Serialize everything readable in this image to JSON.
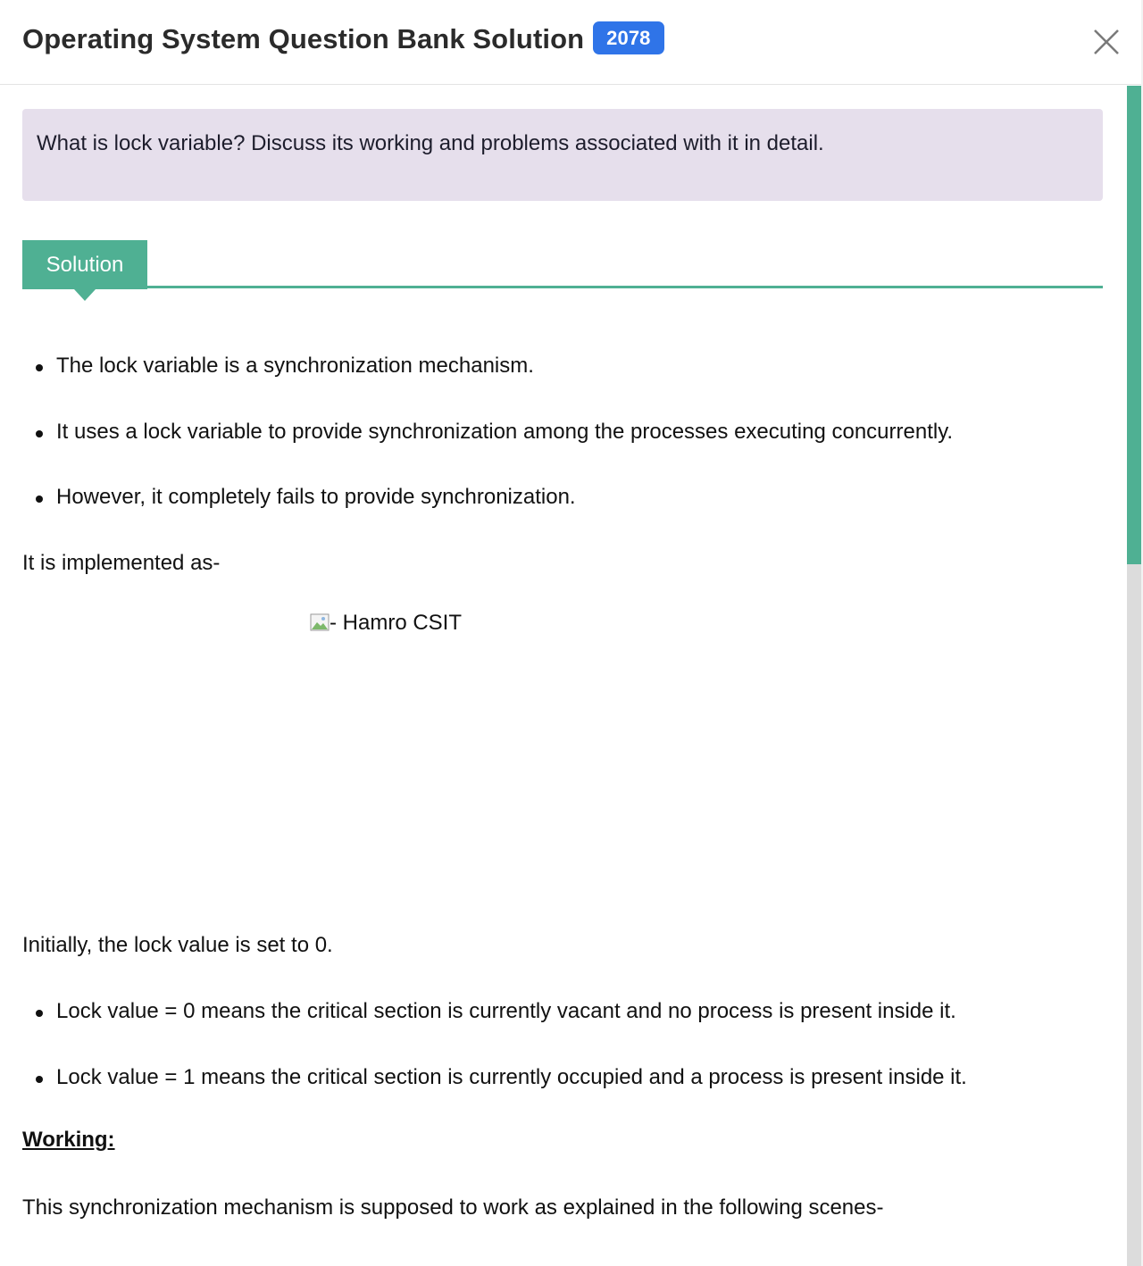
{
  "header": {
    "title": "Operating System Question Bank Solution",
    "year_badge": "2078"
  },
  "question": {
    "text": "What is lock variable? Discuss its working and problems associated with it in detail."
  },
  "solution_tab": {
    "label": "Solution"
  },
  "content": {
    "intro_bullets": [
      "The lock variable is a synchronization mechanism.",
      "It uses a lock variable to provide synchronization among the processes executing concurrently.",
      "However, it completely fails to provide synchronization."
    ],
    "implemented_as": "It is implemented as-",
    "image_alt": "- Hamro CSIT",
    "initially": "Initially, the lock value is set to 0.",
    "lock_bullets": [
      "Lock value = 0 means the critical section is currently vacant and no process is present inside it.",
      "Lock value = 1 means the critical section is currently occupied and a process is present inside it."
    ],
    "working_heading": "Working:",
    "working_text": "This synchronization mechanism is supposed to work as explained in the following scenes-"
  },
  "colors": {
    "accent_green": "#4fb093",
    "badge_blue": "#2f74e8",
    "question_bg": "#e6dfec"
  },
  "icons": {
    "close": "close-icon",
    "broken_image": "broken-image-icon"
  }
}
